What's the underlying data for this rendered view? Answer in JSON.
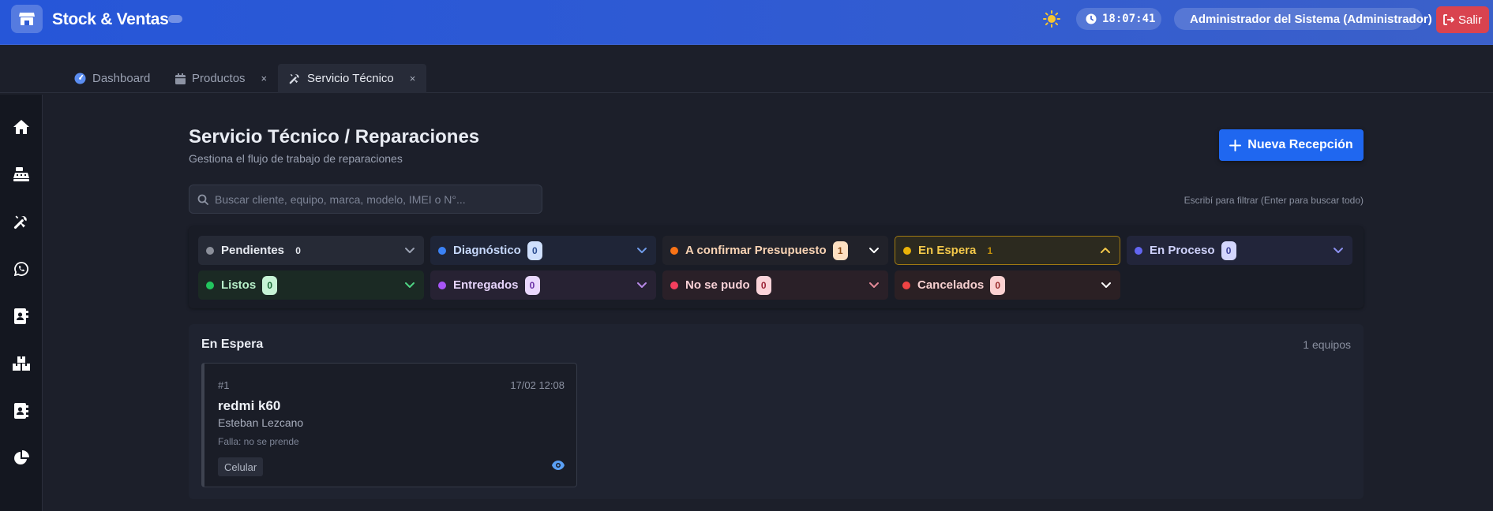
{
  "app": {
    "name": "Stock & Ventas"
  },
  "header": {
    "clock": "18:07:41",
    "user": "Administrador del Sistema (Administrador)",
    "logout_label": "Salir"
  },
  "tabs": [
    {
      "label": "Dashboard",
      "icon": "gauge-icon",
      "closable": false
    },
    {
      "label": "Productos",
      "icon": "calendar-icon",
      "closable": true
    },
    {
      "label": "Servicio Técnico",
      "icon": "tools-icon",
      "closable": true,
      "active": true
    }
  ],
  "tab_close": "×",
  "sidebar": {
    "items": [
      "home-icon",
      "cash-register-icon",
      "tools-icon",
      "whatsapp-icon",
      "contact-card-icon",
      "boxes-icon",
      "address-book-icon",
      "pie-chart-icon"
    ]
  },
  "page": {
    "title": "Servicio Técnico / Reparaciones",
    "subtitle": "Gestiona el flujo de trabajo de reparaciones",
    "new_button": "Nueva Recepción",
    "search_placeholder": "Buscar cliente, equipo, marca, modelo, IMEI o N°...",
    "search_hint": "Escribí para filtrar (Enter para buscar todo)"
  },
  "statuses": [
    {
      "label": "Pendientes",
      "count": "0",
      "color": "#8b8f9a"
    },
    {
      "label": "Diagnóstico",
      "count": "0",
      "color": "#3b82f6"
    },
    {
      "label": "A confirmar Presupuesto",
      "count": "1",
      "color": "#f97316"
    },
    {
      "label": "En Espera",
      "count": "1",
      "color": "#eab308",
      "expanded": true
    },
    {
      "label": "En Proceso",
      "count": "0",
      "color": "#6366f1"
    },
    {
      "label": "Listos",
      "count": "0",
      "color": "#22c55e"
    },
    {
      "label": "Entregados",
      "count": "0",
      "color": "#a855f7"
    },
    {
      "label": "No se pudo",
      "count": "0",
      "color": "#f43f5e"
    },
    {
      "label": "Cancelados",
      "count": "0",
      "color": "#ef4444"
    }
  ],
  "section": {
    "title": "En Espera",
    "count_label": "1 equipos",
    "cards": [
      {
        "number": "#1",
        "date": "17/02 12:08",
        "model": "redmi k60",
        "client": "Esteban Lezcano",
        "fault": "Falla: no se prende",
        "type": "Celular"
      }
    ]
  }
}
